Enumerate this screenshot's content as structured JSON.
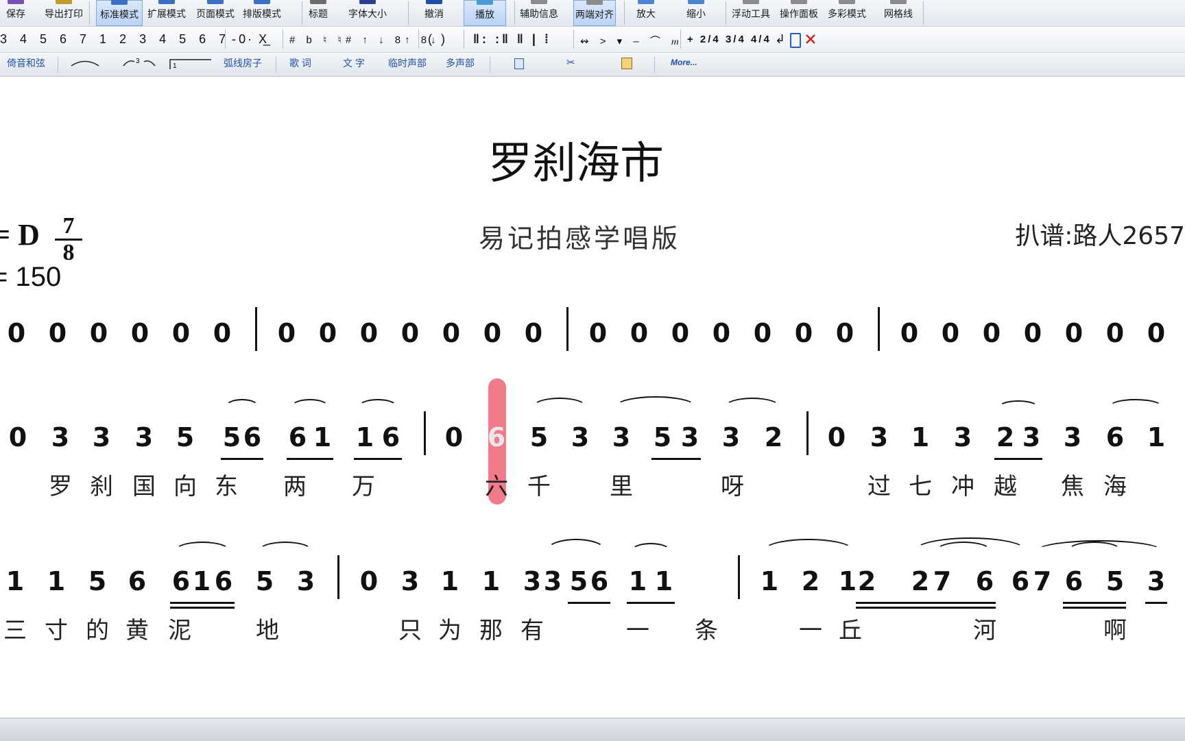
{
  "toolbar_main": [
    {
      "label": "保存",
      "name": "save-button"
    },
    {
      "label": "导出打印",
      "name": "export-print-button"
    },
    {
      "label": "标准模式",
      "name": "standard-mode-button",
      "active": true
    },
    {
      "label": "扩展模式",
      "name": "extended-mode-button"
    },
    {
      "label": "页面模式",
      "name": "page-mode-button"
    },
    {
      "label": "排版模式",
      "name": "layout-mode-button"
    },
    {
      "label": "标题",
      "name": "title-button"
    },
    {
      "label": "字体大小",
      "name": "font-size-button"
    },
    {
      "label": "撤消",
      "name": "undo-button"
    },
    {
      "label": "播放",
      "name": "play-button",
      "active": true
    },
    {
      "label": "辅助信息",
      "name": "aux-info-button"
    },
    {
      "label": "两端对齐",
      "name": "justify-button",
      "active": true
    },
    {
      "label": "放大",
      "name": "zoom-in-button"
    },
    {
      "label": "缩小",
      "name": "zoom-out-button"
    },
    {
      "label": "浮动工具",
      "name": "floating-tools-button"
    },
    {
      "label": "操作面板",
      "name": "operation-panel-button"
    },
    {
      "label": "多彩模式",
      "name": "color-mode-button"
    },
    {
      "label": "网格线",
      "name": "gridlines-button"
    }
  ],
  "toolbar_notes": {
    "digits": "3 4 5 6 7 1 2 3 4 5 6 7 0 X",
    "dashes": "- · _",
    "accidentals": "# b ♮ ♮# ↑ ↓ 8↑ 8↓",
    "parens": "(  )",
    "barlines": "‖: :‖ ‖ | ⁞",
    "marks": "↭ > ▾ – ⌒ 𝆐",
    "timesig": "+ 2/4 3/4 4/4",
    "tail": "↲"
  },
  "toolbar_edit": {
    "grace_chord": "倚音和弦",
    "slur_bracket": "弧线房子",
    "lyrics": "歌 词",
    "text": "文 字",
    "temp_voice": "临时声部",
    "multi_voice": "多声部",
    "more": "More..."
  },
  "score": {
    "title": "罗刹海市",
    "subtitle": "易记拍感学唱版",
    "arranger": "扒谱:路人2657",
    "key": "= D",
    "time_num": "7",
    "time_den": "8",
    "tempo": "= 150"
  },
  "colors": {
    "highlight": "#ef6b7e",
    "accent": "#1f4fa8"
  },
  "current_note": {
    "line": 2,
    "measure": 2,
    "note": 2,
    "digit": "6"
  },
  "line1": {
    "notes": [
      "0",
      "0",
      "0",
      "0",
      "0",
      "0",
      "0",
      "0",
      "0",
      "0",
      "0",
      "0",
      "0",
      "0",
      "0",
      "0",
      "0",
      "0",
      "0",
      "0",
      "0",
      "0",
      "0",
      "0",
      "0",
      "0",
      "0"
    ]
  },
  "line2": {
    "notes": [
      "0",
      "3",
      "3",
      "3",
      "5",
      "5",
      "6",
      "6",
      "1",
      "1",
      "6",
      "0",
      "6",
      "5",
      "3",
      "3",
      "5",
      "3",
      "3",
      "2",
      "0",
      "3",
      "1",
      "3",
      "2",
      "3",
      "3",
      "6",
      "1"
    ],
    "lyrics": [
      "罗",
      "刹",
      "国",
      "向",
      "东",
      "两",
      "万",
      "六",
      "千",
      "里",
      "呀",
      "过",
      "七",
      "冲",
      "越",
      "焦",
      "海"
    ]
  },
  "line3": {
    "notes": [
      "1",
      "1",
      "5",
      "6",
      "6",
      "1",
      "6",
      "5",
      "3",
      "0",
      "3",
      "1",
      "1",
      "3",
      "3",
      "5",
      "6",
      "1",
      "1",
      "1",
      "2",
      "1",
      "2",
      "2",
      "7",
      "6",
      "6",
      "7",
      "6",
      "5",
      "3"
    ],
    "lyrics": [
      "三",
      "寸",
      "的",
      "黄",
      "泥",
      "地",
      "只",
      "为",
      "那",
      "有",
      "一",
      "条",
      "一",
      "丘",
      "河",
      "啊"
    ]
  }
}
